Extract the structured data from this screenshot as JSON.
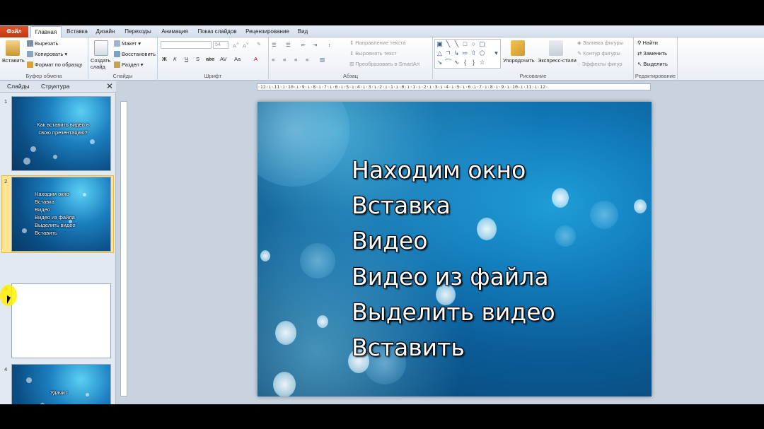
{
  "tabs": {
    "file": "Файл",
    "home": "Главная",
    "items": [
      "Вставка",
      "Дизайн",
      "Переходы",
      "Анимация",
      "Показ слайдов",
      "Рецензирование",
      "Вид"
    ]
  },
  "clipboard": {
    "paste": "Вставить",
    "cut": "Вырезать",
    "copy": "Копировать",
    "format_painter": "Формат по образцу",
    "label": "Буфер обмена"
  },
  "slides_group": {
    "new_slide": "Создать слайд",
    "layout": "Макет",
    "reset": "Восстановить",
    "section": "Раздел",
    "label": "Слайды"
  },
  "font_group": {
    "font_size": "54",
    "buttons": [
      "Ж",
      "К",
      "Ч",
      "S",
      "abc",
      "AV",
      "Aa",
      "A"
    ],
    "label": "Шрифт"
  },
  "paragraph_group": {
    "text_direction": "Направление текста",
    "align_text": "Выровнять текст",
    "smartart": "Преобразовать в SmartArt",
    "label": "Абзац"
  },
  "drawing_group": {
    "arrange": "Упорядочить",
    "quick_styles": "Экспресс-стили",
    "shape_fill": "Заливка фигуры",
    "shape_outline": "Контур фигуры",
    "shape_effects": "Эффекты фигур",
    "label": "Рисование"
  },
  "editing_group": {
    "find": "Найти",
    "replace": "Заменить",
    "select": "Выделить",
    "label": "Редактирование"
  },
  "panel": {
    "tab_slides": "Слайды",
    "tab_outline": "Структура",
    "close": "✕",
    "thumbnails": [
      {
        "num": "1",
        "lines": [
          "Как вставить видео в",
          "свою презентацию?"
        ]
      },
      {
        "num": "2",
        "lines": [
          "Находим окно",
          "Вставка",
          "Видео",
          "Видео из файла",
          "Выделить видео",
          "Вставить"
        ]
      },
      {
        "num": "3",
        "lines": []
      },
      {
        "num": "4",
        "lines": [
          "Удачи !"
        ]
      }
    ]
  },
  "ruler": {
    "horizontal": "·12·ı·11·ı·10·ı·9·ı·8·ı·7·ı·6·ı·5·ı·4·ı·3·ı·2·ı·1·ı·0·ı·1·ı·2·ı·3·ı·4·ı·5·ı·6·ı·7·ı·8·ı·9·ı·10·ı·11·ı·12·"
  },
  "slide": {
    "lines": [
      "Находим окно",
      "Вставка",
      "Видео",
      "Видео из файла",
      "Выделить видео",
      "Вставить"
    ]
  }
}
